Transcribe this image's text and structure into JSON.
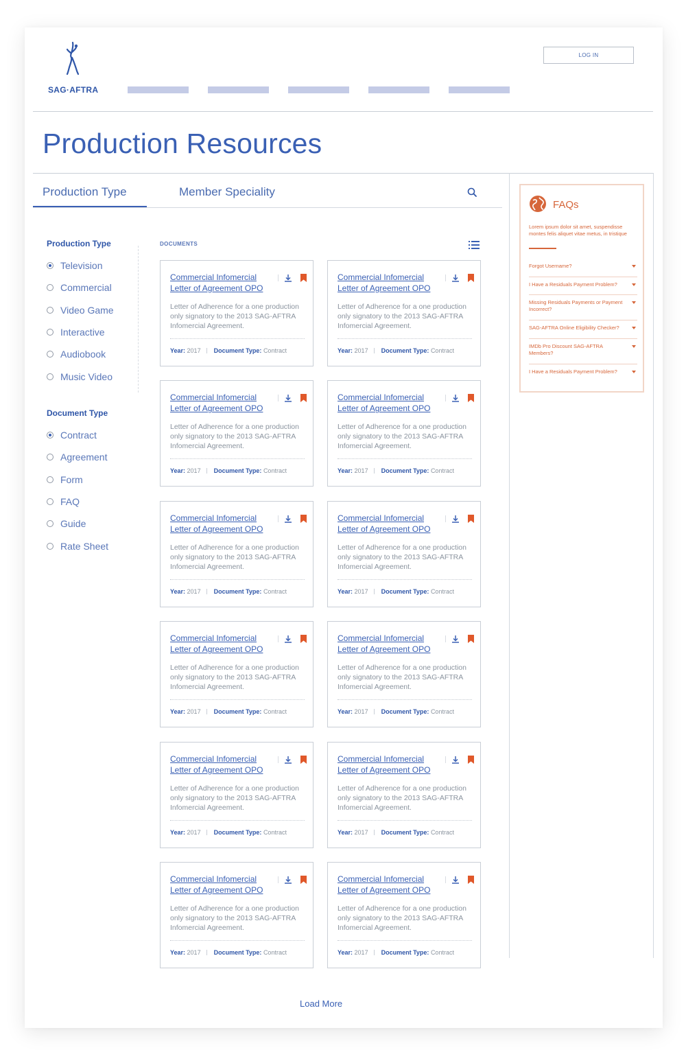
{
  "brand": {
    "name": "SAG·AFTRA"
  },
  "header": {
    "login_label": "LOG IN"
  },
  "page": {
    "title": "Production Resources"
  },
  "tabs": [
    {
      "label": "Production Type",
      "active": true
    },
    {
      "label": "Member Speciality",
      "active": false
    }
  ],
  "filters": {
    "production_type": {
      "heading": "Production Type",
      "options": [
        "Television",
        "Commercial",
        "Video Game",
        "Interactive",
        "Audiobook",
        "Music Video"
      ],
      "selected": "Television"
    },
    "document_type": {
      "heading": "Document Type",
      "options": [
        "Contract",
        "Agreement",
        "Form",
        "FAQ",
        "Guide",
        "Rate Sheet"
      ],
      "selected": "Contract"
    }
  },
  "documents": {
    "label": "DOCUMENTS",
    "card": {
      "title": "Commercial Infomercial Letter of Agreement OPO",
      "description": "Letter of Adherence for a one production only signatory to the 2013 SAG-AFTRA Infomercial Agreement.",
      "year_label": "Year:",
      "year": "2017",
      "type_label": "Document Type:",
      "type": "Contract"
    },
    "rows": 6,
    "cols": 2,
    "load_more": "Load More"
  },
  "faq": {
    "title": "FAQs",
    "intro": "Lorem ipsum dolor sit amet, suspendisse montes felis aliquet vitae metus, in tristique",
    "questions": [
      "Forgot Username?",
      "I Have a Residuals Payment Problem?",
      "Missing Residuals Payments or Payment Incorrect?",
      "SAG-AFTRA Online Eligibility Checker?",
      "IMDb Pro Discount SAG-AFTRA Members?",
      "I Have a Residuals Payment Problem?"
    ]
  },
  "colors": {
    "primary": "#3a60b4",
    "accent": "#d6663a",
    "nav_placeholder": "#c4cbe6"
  },
  "icons": {
    "logo": "sag-aftra-figure-icon",
    "search": "search-icon",
    "list": "list-view-icon",
    "download": "download-icon",
    "bookmark": "bookmark-icon",
    "globe": "globe-icon",
    "chevron": "chevron-down-icon"
  }
}
